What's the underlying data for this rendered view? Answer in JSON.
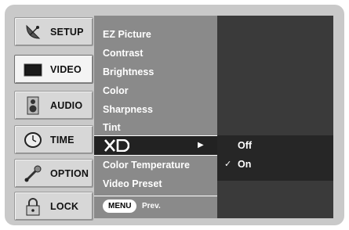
{
  "sidebar": {
    "items": [
      {
        "label": "SETUP",
        "icon": "satellite-dish-icon",
        "active": false
      },
      {
        "label": "VIDEO",
        "icon": "tv-screen-icon",
        "active": true
      },
      {
        "label": "AUDIO",
        "icon": "speaker-icon",
        "active": false
      },
      {
        "label": "TIME",
        "icon": "clock-icon",
        "active": false
      },
      {
        "label": "OPTION",
        "icon": "tools-icon",
        "active": false
      },
      {
        "label": "LOCK",
        "icon": "padlock-icon",
        "active": false
      }
    ]
  },
  "menu": {
    "items": [
      {
        "label": "EZ Picture"
      },
      {
        "label": "Contrast"
      },
      {
        "label": "Brightness"
      },
      {
        "label": "Color"
      },
      {
        "label": "Sharpness"
      },
      {
        "label": "Tint"
      },
      {
        "label": "XD",
        "selected": true,
        "has_submenu": true
      },
      {
        "label": "Color Temperature"
      },
      {
        "label": "Video Preset"
      }
    ],
    "footer": {
      "menu_button": "MENU",
      "prev_label": "Prev."
    }
  },
  "submenu": {
    "options": [
      {
        "label": "Off",
        "checked": false
      },
      {
        "label": "On",
        "checked": true
      }
    ]
  },
  "colors": {
    "frame": "#c9c9c9",
    "menu_bg": "#8a8a8a",
    "selected_bg": "#222222",
    "submenu_bg": "#3a3a3a"
  }
}
